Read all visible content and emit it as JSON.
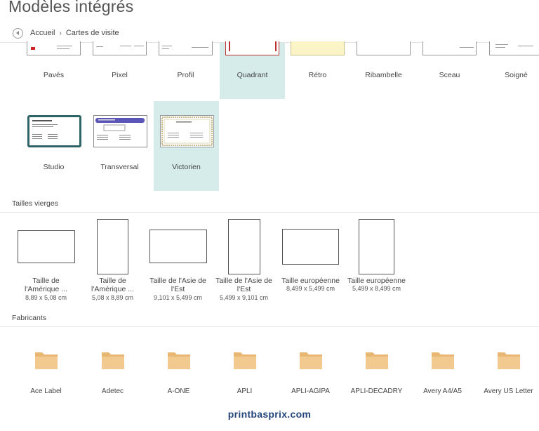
{
  "page": {
    "title": "Modèles intégrés"
  },
  "breadcrumb": {
    "home": "Accueil",
    "separator": "›",
    "current": "Cartes de visite"
  },
  "templates_row1": [
    {
      "name": "Pavés",
      "selected": false
    },
    {
      "name": "Pixel",
      "selected": false
    },
    {
      "name": "Profil",
      "selected": false
    },
    {
      "name": "Quadrant",
      "selected": true
    },
    {
      "name": "Rétro",
      "selected": false
    },
    {
      "name": "Ribambelle",
      "selected": false
    },
    {
      "name": "Sceau",
      "selected": false
    },
    {
      "name": "Soigné",
      "selected": false
    }
  ],
  "templates_row2": [
    {
      "name": "Studio",
      "selected": false
    },
    {
      "name": "Transversal",
      "selected": false
    },
    {
      "name": "Victorien",
      "selected": true
    }
  ],
  "sections": {
    "blank_sizes": "Tailles vierges",
    "manufacturers": "Fabricants"
  },
  "blank_sizes": [
    {
      "name_line1": "Taille de",
      "name_line2": "l'Amérique ...",
      "size": "8,89 x 5,08 cm"
    },
    {
      "name_line1": "Taille de",
      "name_line2": "l'Amérique ...",
      "size": "5,08 x 8,89 cm"
    },
    {
      "name_line1": "Taille de l'Asie de",
      "name_line2": "l'Est",
      "size": "9,101 x 5,499 cm"
    },
    {
      "name_line1": "Taille de l'Asie de",
      "name_line2": "l'Est",
      "size": "5,499 x 9,101 cm"
    },
    {
      "name_line1": "Taille européenne",
      "name_line2": "",
      "size": "8,499 x 5,499 cm"
    },
    {
      "name_line1": "Taille européenne",
      "name_line2": "",
      "size": "5,499 x 8,499 cm"
    }
  ],
  "manufacturers": [
    "Ace Label",
    "Adetec",
    "A-ONE",
    "APLI",
    "APLI-AGIPA",
    "APLI-DECADRY",
    "Avery A4/A5",
    "Avery US Letter"
  ],
  "colors": {
    "selection": "#d5ecea",
    "folder": "#f2c98f",
    "folder_tab": "#e9b774",
    "studio_border": "#2e6466",
    "transversal_band": "#5b55b8",
    "retro_fill": "#fbf4c6"
  },
  "icons": {
    "back": "back-arrow-icon",
    "folder": "folder-icon"
  },
  "watermark": "printbasprix.com"
}
